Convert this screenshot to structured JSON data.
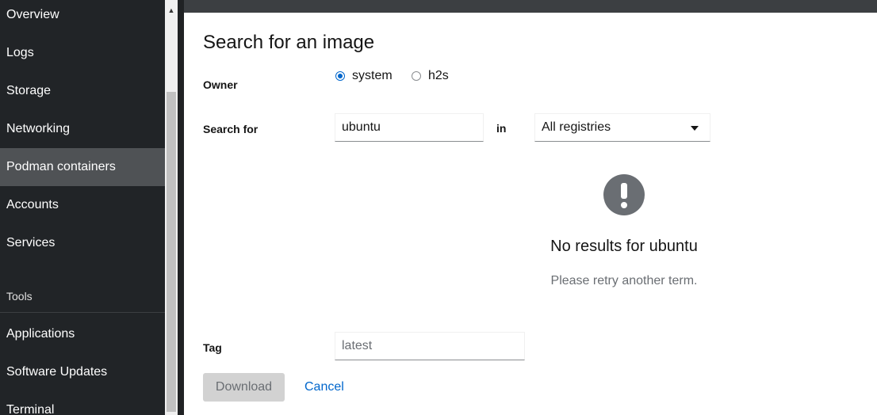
{
  "sidebar": {
    "items": [
      {
        "label": "Overview"
      },
      {
        "label": "Logs"
      },
      {
        "label": "Storage"
      },
      {
        "label": "Networking"
      },
      {
        "label": "Podman containers"
      },
      {
        "label": "Accounts"
      },
      {
        "label": "Services"
      }
    ],
    "section_label": "Tools",
    "tools_items": [
      {
        "label": "Applications"
      },
      {
        "label": "Software Updates"
      },
      {
        "label": "Terminal"
      }
    ],
    "active_item": "Podman containers"
  },
  "dialog": {
    "title": "Search for an image",
    "owner": {
      "label": "Owner",
      "options": [
        {
          "label": "system",
          "selected": true
        },
        {
          "label": "h2s",
          "selected": false
        }
      ]
    },
    "search": {
      "label": "Search for",
      "value": "ubuntu",
      "in_label": "in",
      "registry_selected": "All registries"
    },
    "empty_state": {
      "title": "No results for ubuntu",
      "body": "Please retry another term."
    },
    "tag": {
      "label": "Tag",
      "value": "latest"
    },
    "buttons": {
      "download": "Download",
      "cancel": "Cancel"
    }
  },
  "colors": {
    "sidebar_bg": "#212427",
    "active_bg": "#4f5255",
    "link": "#0066cc",
    "radio_accent": "#0066cc"
  }
}
